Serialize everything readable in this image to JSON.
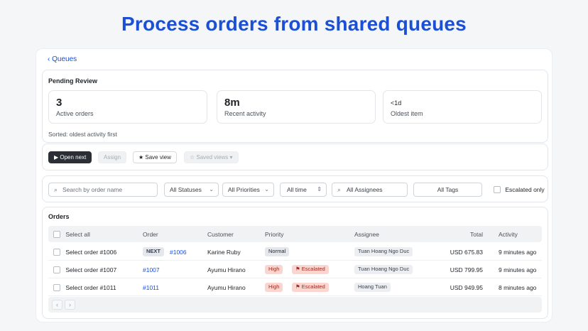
{
  "headline": "Process orders from shared queues",
  "nav": {
    "back_label": "‹ Queues"
  },
  "pending": {
    "title": "Pending Review",
    "stats": [
      {
        "value": "3",
        "label": "Active orders"
      },
      {
        "value": "8m",
        "label": "Recent activity"
      },
      {
        "value": "<1d",
        "label": "Oldest item"
      }
    ],
    "sorted_text": "Sorted: oldest activity first"
  },
  "toolbar": {
    "open_next": "▶ Open next",
    "assign": "Assign",
    "save_view": "★ Save view",
    "saved_views": "☆ Saved views ▾"
  },
  "filters": {
    "search_placeholder": "Search by order name",
    "status": "All Statuses",
    "priority": "All Priorities",
    "time": "All time",
    "assignees": "All Assignees",
    "tags": "All Tags",
    "escalated_only": "Escalated only"
  },
  "orders": {
    "title": "Orders",
    "columns": {
      "select_all": "Select all",
      "order": "Order",
      "customer": "Customer",
      "priority": "Priority",
      "assignee": "Assignee",
      "total": "Total",
      "activity": "Activity"
    },
    "rows": [
      {
        "select": "Select order #1006",
        "badge": "NEXT",
        "order": "#1006",
        "customer": "Karine Ruby",
        "priority": "Normal",
        "escalated": "",
        "assignee": "Tuan Hoang Ngo Duc",
        "total": "USD 675.83",
        "activity": "9 minutes ago"
      },
      {
        "select": "Select order #1007",
        "badge": "",
        "order": "#1007",
        "customer": "Ayumu Hirano",
        "priority": "High",
        "escalated": "⚑ Escalated",
        "assignee": "Tuan Hoang Ngo Duc",
        "total": "USD 799.95",
        "activity": "9 minutes ago"
      },
      {
        "select": "Select order #1011",
        "badge": "",
        "order": "#1011",
        "customer": "Ayumu Hirano",
        "priority": "High",
        "escalated": "⚑ Escalated",
        "assignee": "Hoang Tuan",
        "total": "USD 949.95",
        "activity": "8 minutes ago"
      }
    ],
    "pager": {
      "prev": "‹",
      "next": "›"
    }
  }
}
